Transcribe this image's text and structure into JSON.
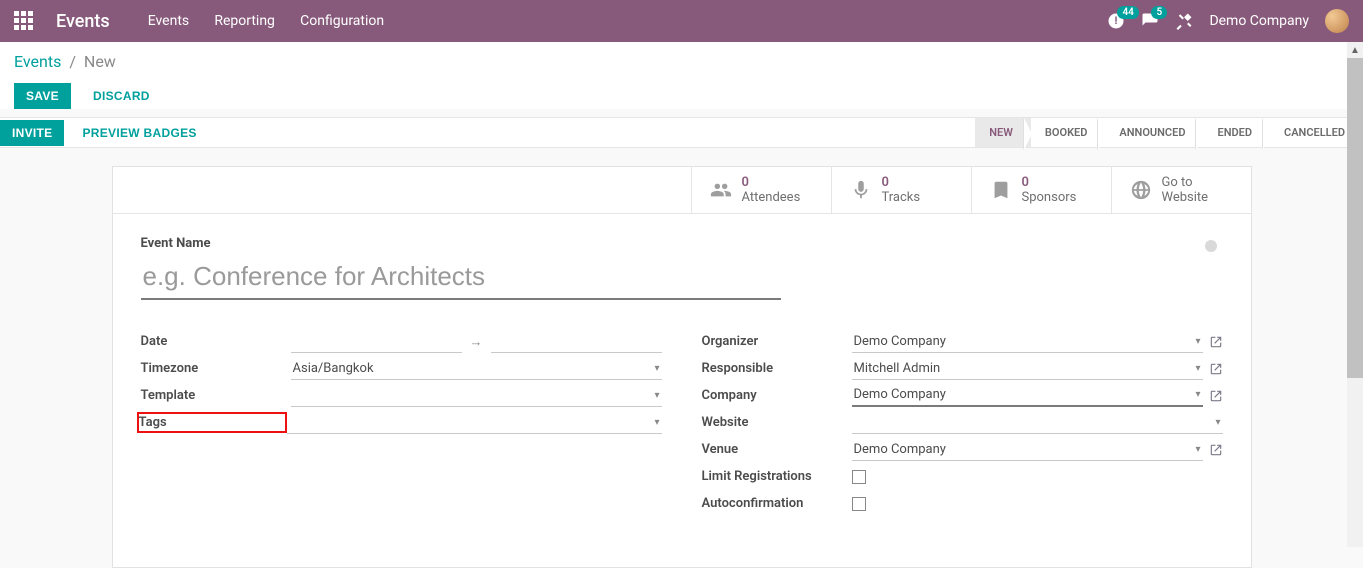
{
  "topbar": {
    "brand": "Events",
    "nav": [
      "Events",
      "Reporting",
      "Configuration"
    ],
    "clock_badge": "44",
    "chat_badge": "5",
    "company": "Demo Company"
  },
  "breadcrumb": {
    "root": "Events",
    "current": "New"
  },
  "buttons": {
    "save": "SAVE",
    "discard": "DISCARD",
    "invite": "INVITE",
    "preview": "PREVIEW BADGES"
  },
  "stages": [
    {
      "label": "NEW",
      "active": true
    },
    {
      "label": "BOOKED",
      "active": false
    },
    {
      "label": "ANNOUNCED",
      "active": false
    },
    {
      "label": "ENDED",
      "active": false
    },
    {
      "label": "CANCELLED",
      "active": false
    }
  ],
  "stats": {
    "attendees": {
      "count": "0",
      "label": "Attendees"
    },
    "tracks": {
      "count": "0",
      "label": "Tracks"
    },
    "sponsors": {
      "count": "0",
      "label": "Sponsors"
    },
    "website": {
      "line1": "Go to",
      "line2": "Website"
    }
  },
  "form": {
    "event_name": {
      "label": "Event Name",
      "placeholder": "e.g. Conference for Architects",
      "value": ""
    },
    "left": {
      "date": {
        "label": "Date",
        "start": "",
        "end": ""
      },
      "timezone": {
        "label": "Timezone",
        "value": "Asia/Bangkok"
      },
      "template": {
        "label": "Template",
        "value": ""
      },
      "tags": {
        "label": "Tags",
        "value": ""
      }
    },
    "right": {
      "organizer": {
        "label": "Organizer",
        "value": "Demo Company"
      },
      "responsible": {
        "label": "Responsible",
        "value": "Mitchell Admin"
      },
      "company": {
        "label": "Company",
        "value": "Demo Company"
      },
      "website": {
        "label": "Website",
        "value": ""
      },
      "venue": {
        "label": "Venue",
        "value": "Demo Company"
      },
      "limit": {
        "label": "Limit Registrations",
        "checked": false
      },
      "autoconfirm": {
        "label": "Autoconfirmation",
        "checked": false
      }
    }
  }
}
